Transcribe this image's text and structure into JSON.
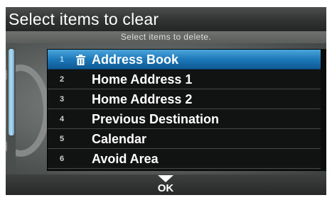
{
  "title": "Select items to clear",
  "subtitle": "Select items to delete.",
  "items": [
    {
      "number": "1",
      "label": "Address Book",
      "selected": true,
      "icon": "trash-icon"
    },
    {
      "number": "2",
      "label": "Home Address 1",
      "selected": false
    },
    {
      "number": "3",
      "label": "Home Address 2",
      "selected": false
    },
    {
      "number": "4",
      "label": "Previous Destination",
      "selected": false
    },
    {
      "number": "5",
      "label": "Calendar",
      "selected": false
    },
    {
      "number": "6",
      "label": "Avoid Area",
      "selected": false
    }
  ],
  "ok_button": {
    "label": "OK",
    "icon": "down-arrow-icon"
  },
  "colors": {
    "selection": "#1e78b8",
    "background": "#1a1e1c",
    "text": "#ffffff"
  }
}
